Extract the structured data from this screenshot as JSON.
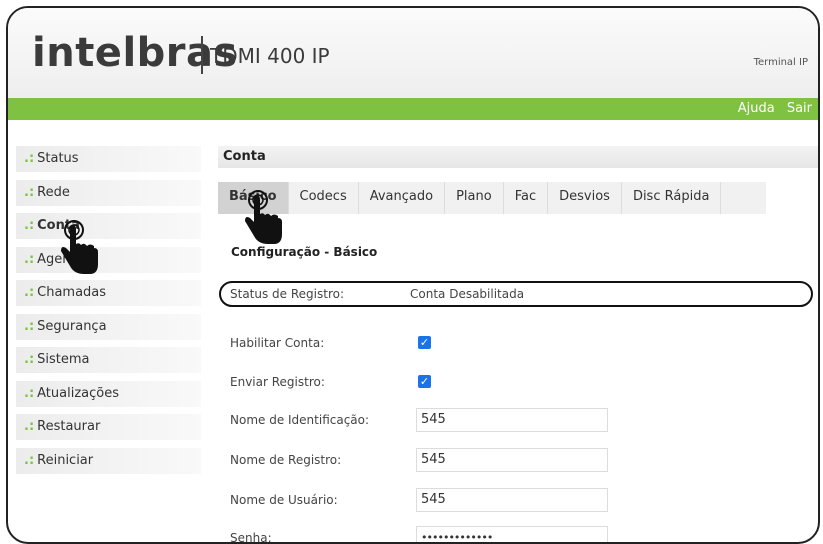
{
  "header": {
    "logo": "intelbras",
    "product": "TDMI 400 IP",
    "terminal": "Terminal IP",
    "links": [
      "Ajuda",
      "Sair"
    ]
  },
  "sidebar": {
    "items": [
      {
        "label": "Status"
      },
      {
        "label": "Rede"
      },
      {
        "label": "Conta"
      },
      {
        "label": "Agenda"
      },
      {
        "label": "Chamadas"
      },
      {
        "label": "Segurança"
      },
      {
        "label": "Sistema"
      },
      {
        "label": "Atualizações"
      },
      {
        "label": "Restaurar"
      },
      {
        "label": "Reiniciar"
      }
    ],
    "prefix": ".:"
  },
  "main": {
    "section_title": "Conta",
    "tabs": [
      "Básico",
      "Codecs",
      "Avançado",
      "Plano",
      "Fac",
      "Desvios",
      "Disc Rápida"
    ],
    "subtitle": "Configuração - Básico",
    "fields": {
      "status_label": "Status de Registro:",
      "status_value": "Conta Desabilitada",
      "habilitar_label": "Habilitar Conta:",
      "enviar_label": "Enviar Registro:",
      "nome_id_label": "Nome de Identificação:",
      "nome_id_value": "545",
      "nome_reg_label": "Nome de Registro:",
      "nome_reg_value": "545",
      "nome_usuario_label": "Nome de Usuário:",
      "nome_usuario_value": "545",
      "senha_label": "Senha:",
      "senha_value": "•••••••••••••"
    }
  },
  "colors": {
    "accent_green": "#7fc241",
    "checkbox_blue": "#1a73e8"
  }
}
